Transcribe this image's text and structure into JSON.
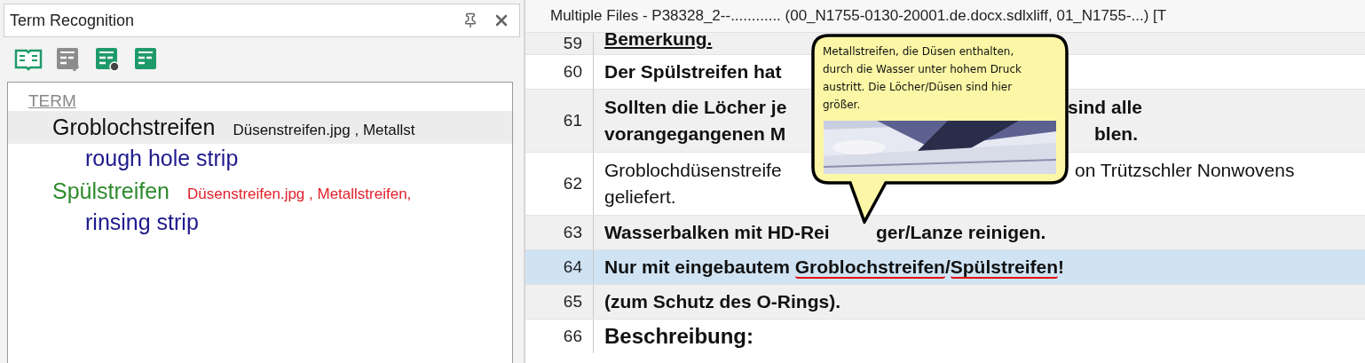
{
  "term_panel": {
    "title": "Term Recognition",
    "list_header": "TERM",
    "entries": [
      {
        "term": "Groblochstreifen",
        "color": "#111111",
        "selected": true,
        "sources": {
          "text": "Düsenstreifen.jpg , Metallst",
          "color": "#111111"
        },
        "translation": "rough hole strip"
      },
      {
        "term": "Spülstreifen",
        "color": "#2e8b2e",
        "selected": false,
        "sources": {
          "text": "Düsenstreifen.jpg , Metallstreifen,",
          "color": "#e0202a"
        },
        "translation": "rinsing strip"
      }
    ]
  },
  "editor": {
    "title": "Multiple Files - P38328_2--............ (00_N1755-0130-20001.de.docx.sdlxliff, 01_N1755-...) [T",
    "rows": [
      {
        "number": "59",
        "kind": "partial",
        "selected": false,
        "lines": [
          [
            [
              {
                "text": "Bemerkung.",
                "term": false
              }
            ]
          ]
        ]
      },
      {
        "number": "60",
        "kind": "bold",
        "selected": false,
        "lines": [
          [
            [
              {
                "text": "Der Spülstreifen hat",
                "term": false
              }
            ]
          ]
        ]
      },
      {
        "number": "61",
        "kind": "bold",
        "selected": false,
        "lines": [
          [
            [
              {
                "text": "Sollten die Löcher je",
                "term": false
              }
            ],
            [
              {
                "text": "sind alle",
                "term": false
              }
            ]
          ],
          [
            [
              {
                "text": "vorangegangenen M",
                "term": false
              }
            ],
            [
              {
                "text": "blen.",
                "term": false
              }
            ]
          ]
        ]
      },
      {
        "number": "62",
        "kind": "plain",
        "selected": false,
        "lines": [
          [
            [
              {
                "text": "Groblochdüsenstreife",
                "term": false
              }
            ],
            [
              {
                "text": "on Trützschler Nonwovens",
                "term": false
              }
            ]
          ],
          [
            [
              {
                "text": "geliefert.",
                "term": false
              }
            ]
          ]
        ]
      },
      {
        "number": "63",
        "kind": "bold",
        "selected": false,
        "lines": [
          [
            [
              {
                "text": "Wasserbalken mit HD-Rei",
                "term": false
              }
            ],
            [
              {
                "text": "ger/Lanze reinigen.",
                "term": false
              }
            ]
          ]
        ]
      },
      {
        "number": "64",
        "kind": "bold",
        "selected": true,
        "lines": [
          [
            [
              {
                "text": "Nur mit eingebautem ",
                "term": false
              },
              {
                "text": "Groblochstreifen",
                "term": true
              },
              {
                "text": "/",
                "term": false
              },
              {
                "text": "Spülstreifen",
                "term": true
              },
              {
                "text": "!",
                "term": false
              }
            ]
          ]
        ]
      },
      {
        "number": "65",
        "kind": "bold",
        "selected": false,
        "lines": [
          [
            [
              {
                "text": "(zum Schutz des O-Rings).",
                "term": false
              }
            ]
          ]
        ]
      },
      {
        "number": "66",
        "kind": "heading",
        "selected": false,
        "lines": [
          [
            [
              {
                "text": "Beschreibung:",
                "term": false
              }
            ]
          ]
        ]
      }
    ],
    "tooltip": {
      "text": "Metallstreifen, die Düsen enthalten, durch die Wasser unter hohem Druck austritt. Die Löcher/Düsen sind hier größer."
    }
  }
}
